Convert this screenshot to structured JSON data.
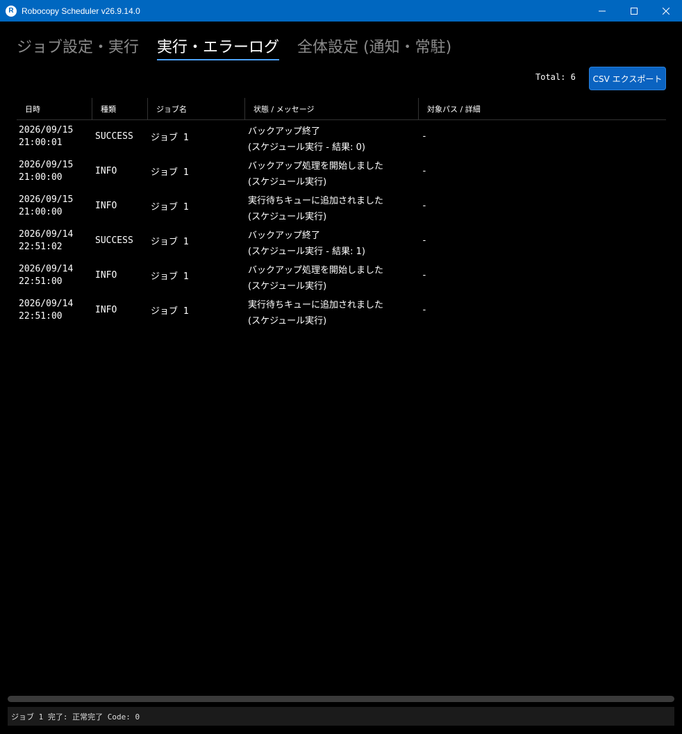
{
  "window": {
    "icon_letter": "R",
    "title": "Robocopy Scheduler v26.9.14.0"
  },
  "tabs": [
    {
      "label": "ジョブ設定・実行"
    },
    {
      "label": "実行・エラーログ"
    },
    {
      "label": "全体設定 (通知・常駐)"
    }
  ],
  "active_tab": 1,
  "toolbar": {
    "total_label": "Total: 6",
    "export_label": "CSV エクスポート"
  },
  "table": {
    "headers": [
      "日時",
      "種類",
      "ジョブ名",
      "状態 / メッセージ",
      "対象パス / 詳細"
    ],
    "rows": [
      {
        "date": "2026/09/15",
        "time": "21:00:01",
        "type": "SUCCESS",
        "job": "ジョブ 1",
        "msg1": "バックアップ終了",
        "msg2": "(スケジュール実行 - 結果: 0)",
        "detail": "-"
      },
      {
        "date": "2026/09/15",
        "time": "21:00:00",
        "type": "INFO",
        "job": "ジョブ 1",
        "msg1": "バックアップ処理を開始しました",
        "msg2": "(スケジュール実行)",
        "detail": "-"
      },
      {
        "date": "2026/09/15",
        "time": "21:00:00",
        "type": "INFO",
        "job": "ジョブ 1",
        "msg1": "実行待ちキューに追加されました",
        "msg2": "(スケジュール実行)",
        "detail": "-"
      },
      {
        "date": "2026/09/14",
        "time": "22:51:02",
        "type": "SUCCESS",
        "job": "ジョブ 1",
        "msg1": "バックアップ終了",
        "msg2": "(スケジュール実行 - 結果: 1)",
        "detail": "-"
      },
      {
        "date": "2026/09/14",
        "time": "22:51:00",
        "type": "INFO",
        "job": "ジョブ 1",
        "msg1": "バックアップ処理を開始しました",
        "msg2": "(スケジュール実行)",
        "detail": "-"
      },
      {
        "date": "2026/09/14",
        "time": "22:51:00",
        "type": "INFO",
        "job": "ジョブ 1",
        "msg1": "実行待ちキューに追加されました",
        "msg2": "(スケジュール実行)",
        "detail": "-"
      }
    ]
  },
  "status": {
    "text": "ジョブ 1 完了: 正常完了 Code: 0"
  },
  "colors": {
    "titlebar": "#0067c0",
    "accent": "#0a63c1",
    "tab_underline": "#4da3ff",
    "background": "#000000"
  },
  "icons": [
    "app-logo-icon",
    "minimize-icon",
    "maximize-icon",
    "close-icon"
  ]
}
